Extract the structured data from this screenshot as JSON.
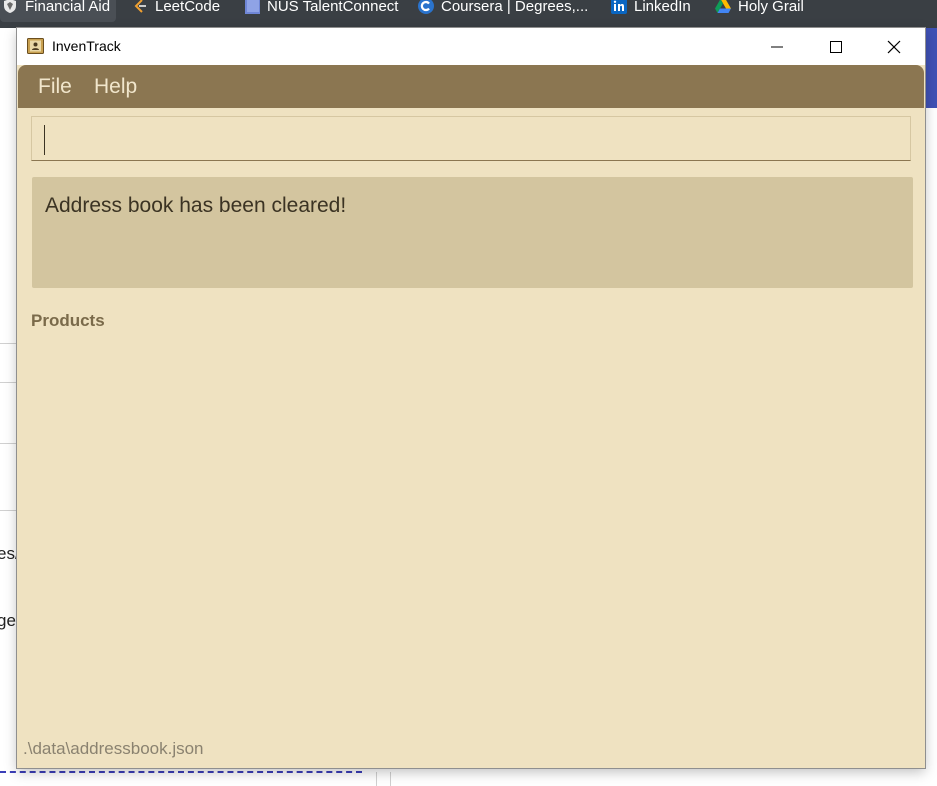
{
  "browser": {
    "bookmarks": [
      {
        "label": "Financial Aid",
        "icon": "shield-icon",
        "active": true
      },
      {
        "label": "LeetCode",
        "icon": "leetcode-icon",
        "active": false
      },
      {
        "label": "NUS TalentConnect",
        "icon": "document-icon",
        "active": false
      },
      {
        "label": "Coursera | Degrees,...",
        "icon": "coursera-icon",
        "active": false
      },
      {
        "label": "LinkedIn",
        "icon": "linkedin-icon",
        "active": false
      },
      {
        "label": "Holy Grail",
        "icon": "google-drive-icon",
        "active": false
      }
    ],
    "background_fragments": [
      "es/",
      "ge."
    ]
  },
  "window": {
    "title": "InvenTrack",
    "controls": {
      "minimize": "minimize-icon",
      "maximize": "maximize-icon",
      "close": "close-icon"
    }
  },
  "menu": {
    "items": [
      {
        "label": "File"
      },
      {
        "label": "Help"
      }
    ]
  },
  "command_box": {
    "value": ""
  },
  "result": {
    "message": "Address book has been cleared!"
  },
  "products": {
    "heading": "Products"
  },
  "status_bar": {
    "path": ".\\data\\addressbook.json"
  },
  "colors": {
    "window_bg": "#efe2c1",
    "menubar_bg": "#8b7651",
    "result_bg": "#d3c59f",
    "browser_bar_bg": "#3a3f44",
    "browser_accent": "#3f51b5"
  }
}
